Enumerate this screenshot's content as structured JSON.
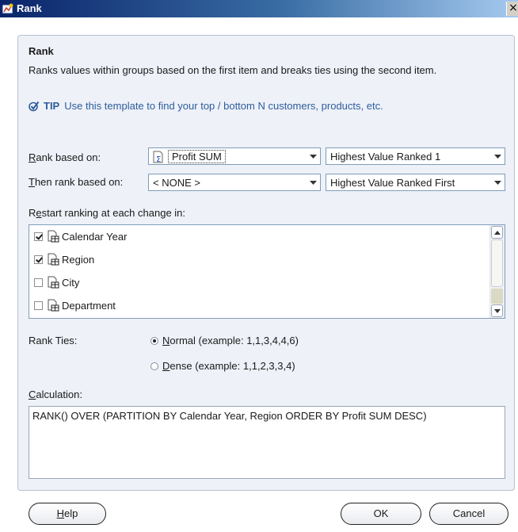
{
  "window": {
    "title": "Rank",
    "close_glyph": "×"
  },
  "header": {
    "title": "Rank",
    "description": "Ranks values within groups based on the first item and breaks ties using the second item.",
    "tip_label": "TIP",
    "tip_text": "Use this template to find your top / bottom N customers, products, etc."
  },
  "rank_based_on": {
    "label_mnemonic": "R",
    "label_rest": "ank based on:",
    "value": "Profit SUM",
    "value_icon": "measure-icon",
    "order": "Highest Value Ranked 1"
  },
  "then_rank_based_on": {
    "label_mnemonic": "T",
    "label_rest": "hen rank based on:",
    "value": "< NONE >",
    "order": "Highest Value Ranked First"
  },
  "restart": {
    "label_pre": "R",
    "label_mnemonic": "e",
    "label_rest": "start ranking at each change in:",
    "items": [
      {
        "label": "Calendar Year",
        "checked": true
      },
      {
        "label": "Region",
        "checked": true
      },
      {
        "label": "City",
        "checked": false
      },
      {
        "label": "Department",
        "checked": false
      }
    ]
  },
  "rank_ties": {
    "label": "Rank Ties:",
    "normal_mnemonic": "N",
    "normal_rest": "ormal (example: 1,1,3,4,4,6)",
    "dense_mnemonic": "D",
    "dense_rest": "ense (example: 1,1,2,3,3,4)",
    "selected": "Normal"
  },
  "calculation": {
    "label_mnemonic": "C",
    "label_rest": "alculation:",
    "text": "RANK() OVER (PARTITION BY Calendar Year, Region ORDER BY Profit SUM DESC)"
  },
  "buttons": {
    "help_mnemonic": "H",
    "help_rest": "elp",
    "ok": "OK",
    "cancel": "Cancel"
  },
  "colors": {
    "accent": "#2d5d9c",
    "titlebar": "#0a246a",
    "panel": "#eef1f8"
  }
}
